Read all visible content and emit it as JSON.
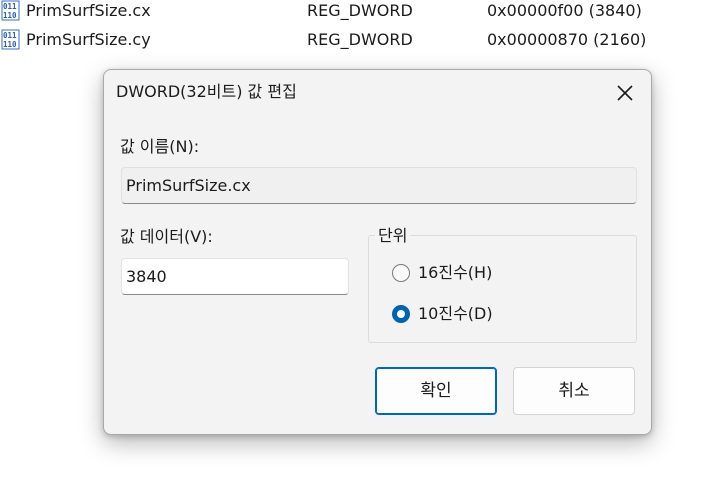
{
  "registry_rows": [
    {
      "name": "PrimSurfSize.cx",
      "type": "REG_DWORD",
      "data": "0x00000f00 (3840)",
      "icon": "registry-binary-value-icon"
    },
    {
      "name": "PrimSurfSize.cy",
      "type": "REG_DWORD",
      "data": "0x00000870 (2160)",
      "icon": "registry-binary-value-icon"
    }
  ],
  "dialog": {
    "title": "DWORD(32비트) 값 편집",
    "close_icon": "close-icon",
    "value_name_label": "값 이름(N):",
    "value_name": "PrimSurfSize.cx",
    "value_data_label": "값 데이터(V):",
    "value_data": "3840",
    "base_group_label": "단위",
    "base_options": [
      {
        "label": "16진수(H)",
        "checked": false
      },
      {
        "label": "10진수(D)",
        "checked": true
      }
    ],
    "ok_label": "확인",
    "cancel_label": "취소",
    "accent_color": "#0067c0"
  }
}
